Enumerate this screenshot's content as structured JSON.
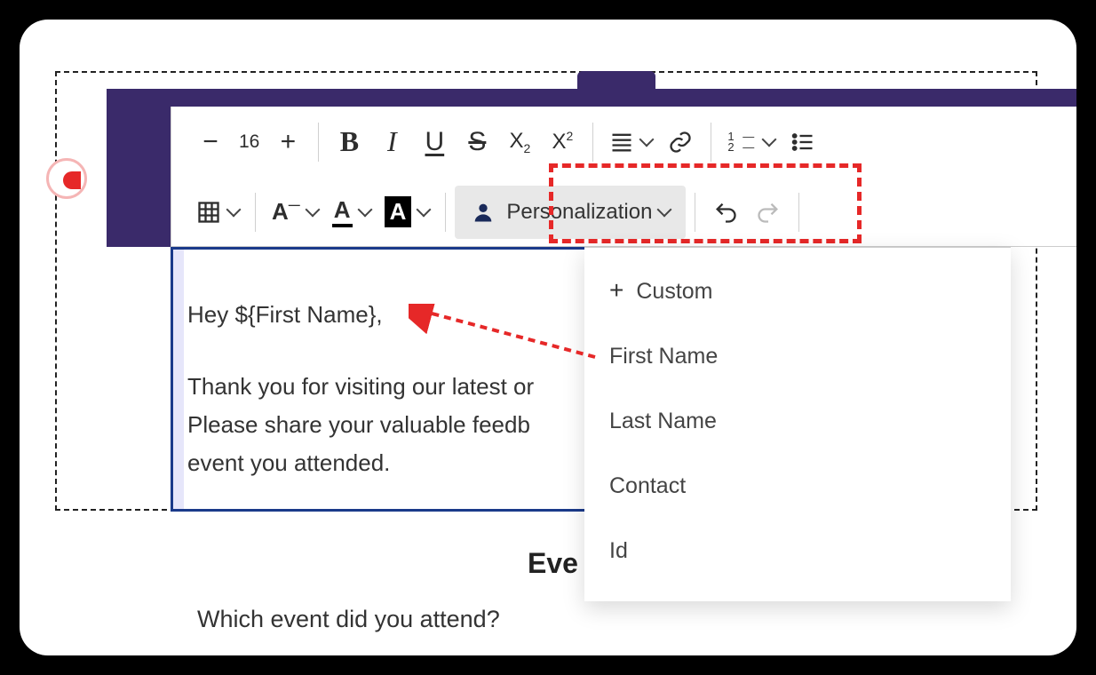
{
  "toolbar": {
    "font_size": "16",
    "personalization_label": "Personalization"
  },
  "dropdown": {
    "items": [
      {
        "label": "Custom",
        "kind": "custom"
      },
      {
        "label": "First Name",
        "kind": "field"
      },
      {
        "label": "Last Name",
        "kind": "field"
      },
      {
        "label": "Contact",
        "kind": "field"
      },
      {
        "label": "Id",
        "kind": "field"
      }
    ]
  },
  "editor": {
    "line1": "Hey ${First Name},",
    "line2a": "Thank you for visiting our latest or",
    "line2b": "Please share your valuable feedb",
    "line2c": "event you attended."
  },
  "below": {
    "heading": "Eve",
    "question": "Which event did you attend?"
  }
}
